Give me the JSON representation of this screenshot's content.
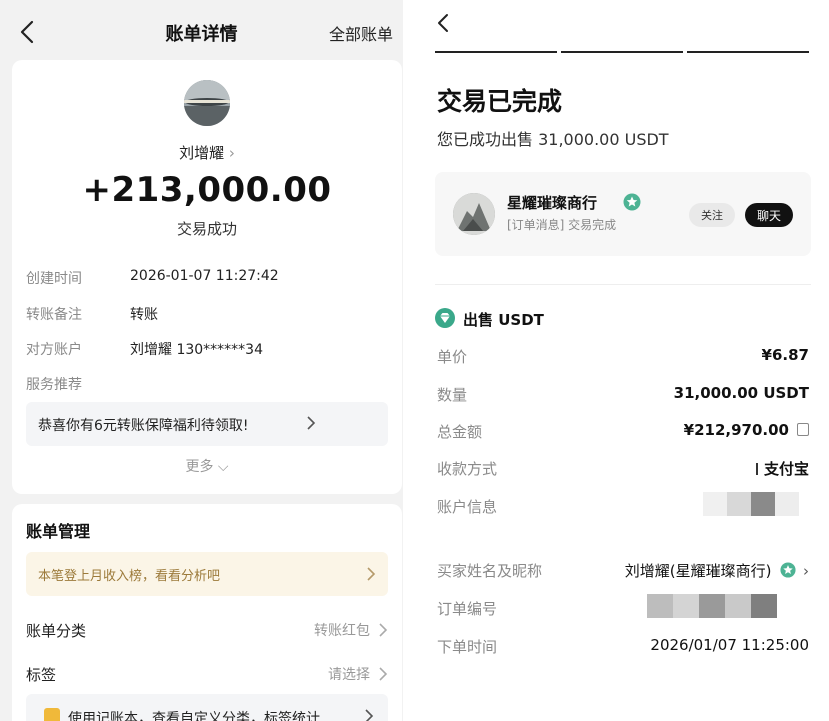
{
  "left": {
    "nav": {
      "title": "账单详情",
      "right": "全部账单"
    },
    "payee": "刘增耀",
    "amount": "+213,000.00",
    "status": "交易成功",
    "info": [
      {
        "key": "创建时间",
        "value": "2026-01-07 11:27:42"
      },
      {
        "key": "转账备注",
        "value": "转账"
      },
      {
        "key": "对方账户",
        "value": "刘增耀 130******34"
      },
      {
        "key": "服务推荐",
        "value": ""
      }
    ],
    "promo": "恭喜你有6元转账保障福利待领取!",
    "more": "更多",
    "manage": {
      "heading": "账单管理",
      "banner": "本笔登上月收入榜，看看分析吧",
      "rows": [
        {
          "key": "账单分类",
          "value": "转账红包"
        },
        {
          "key": "标签",
          "value": "请选择"
        }
      ],
      "banner2": "使用记账本，查看自定义分类，标签统计"
    }
  },
  "right": {
    "title": "交易已完成",
    "subtitle": "您已成功出售 31,000.00 USDT",
    "merchant": {
      "name": "星耀璀璨商行",
      "tag": "[订单消息] 交易完成",
      "follow": "关注",
      "chat": "聊天"
    },
    "section": "出售 USDT",
    "rows": [
      {
        "key": "单价",
        "value": "¥6.87"
      },
      {
        "key": "数量",
        "value": "31,000.00 USDT"
      },
      {
        "key": "总金额",
        "value": "¥212,970.00"
      },
      {
        "key": "收款方式",
        "value": "支付宝"
      },
      {
        "key": "账户信息",
        "value": ""
      },
      {
        "key": "买家姓名及昵称",
        "value": "刘增耀(星耀璀璨商行)"
      },
      {
        "key": "订单编号",
        "value": ""
      },
      {
        "key": "下单时间",
        "value": "2026/01/07 11:25:00"
      }
    ]
  },
  "icons": [
    "back-icon",
    "chevron-right-icon",
    "chevron-down-icon",
    "verified-badge-icon",
    "copy-icon",
    "diamond-icon"
  ],
  "colors": {
    "accent_green": "#3aa88a",
    "promo_bg": "#fbf5e7",
    "promo_text": "#9c7a3a"
  }
}
